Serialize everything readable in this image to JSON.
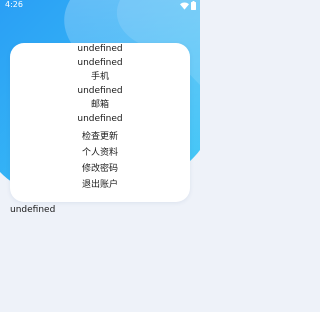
{
  "status_bar": {
    "time": "4:26",
    "icons": [
      "wifi-icon",
      "battery-icon"
    ]
  },
  "colors": {
    "header_gradient_start": "#2ea7f5",
    "header_gradient_end": "#3cc5f5",
    "page_background": "#eef2f9",
    "card_background": "#ffffff"
  },
  "profile": {
    "line1": "undefined",
    "line2": "undefined",
    "phone_label": "手机",
    "phone_value": "undefined",
    "email_label": "邮箱",
    "email_value": "undefined"
  },
  "menu": {
    "check_update": "检查更新",
    "personal_info": "个人资料",
    "change_password": "修改密码",
    "logout": "退出账户"
  },
  "footer": {
    "text": "undefined"
  }
}
